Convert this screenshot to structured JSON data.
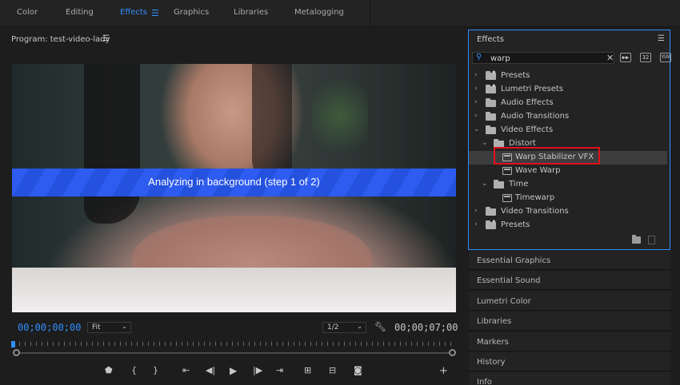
{
  "workspaces": {
    "tabs": [
      "Color",
      "Editing",
      "Effects",
      "Graphics",
      "Libraries",
      "Metalogging"
    ],
    "active": "Effects",
    "accent_color": "#2f8fff"
  },
  "program_monitor": {
    "title": "Program: test-video-lady",
    "menu_icon": "hamburger-icon",
    "overlay_text": "Analyzing in background (step 1 of 2)",
    "overlay_color": "#2e5cf0",
    "timecode_current": "00;00;00;00",
    "timecode_duration": "00;00;07;00",
    "zoom": "Fit",
    "resolution": "1/2",
    "transport_icons": [
      "marker-icon",
      "mark-in-icon",
      "mark-out-icon",
      "go-to-in-icon",
      "step-back-icon",
      "play-icon",
      "step-forward-icon",
      "go-to-out-icon",
      "lift-icon",
      "extract-icon",
      "export-frame-icon",
      "add-button-icon"
    ]
  },
  "effects_panel": {
    "title": "Effects",
    "search_value": "warp",
    "filter_badges": [
      "▶▶",
      "32",
      "YUV"
    ],
    "tree": [
      {
        "label": "Presets",
        "indent": 0,
        "kind": "folder-star",
        "expanded": false
      },
      {
        "label": "Lumetri Presets",
        "indent": 0,
        "kind": "folder-star",
        "expanded": false
      },
      {
        "label": "Audio Effects",
        "indent": 0,
        "kind": "folder",
        "expanded": false
      },
      {
        "label": "Audio Transitions",
        "indent": 0,
        "kind": "folder",
        "expanded": false
      },
      {
        "label": "Video Effects",
        "indent": 0,
        "kind": "folder",
        "expanded": true
      },
      {
        "label": "Distort",
        "indent": 1,
        "kind": "folder",
        "expanded": true
      },
      {
        "label": "Warp Stabilizer VFX",
        "indent": 2,
        "kind": "effect",
        "selected": true
      },
      {
        "label": "Wave Warp",
        "indent": 2,
        "kind": "effect"
      },
      {
        "label": "Time",
        "indent": 1,
        "kind": "folder",
        "expanded": true
      },
      {
        "label": "Timewarp",
        "indent": 2,
        "kind": "effect"
      },
      {
        "label": "Video Transitions",
        "indent": 0,
        "kind": "folder",
        "expanded": false
      },
      {
        "label": "Presets",
        "indent": 0,
        "kind": "folder-star",
        "expanded": false
      }
    ],
    "highlight_color": "#e0101a"
  },
  "side_panels": [
    "Essential Graphics",
    "Essential Sound",
    "Lumetri Color",
    "Libraries",
    "Markers",
    "History",
    "Info"
  ]
}
